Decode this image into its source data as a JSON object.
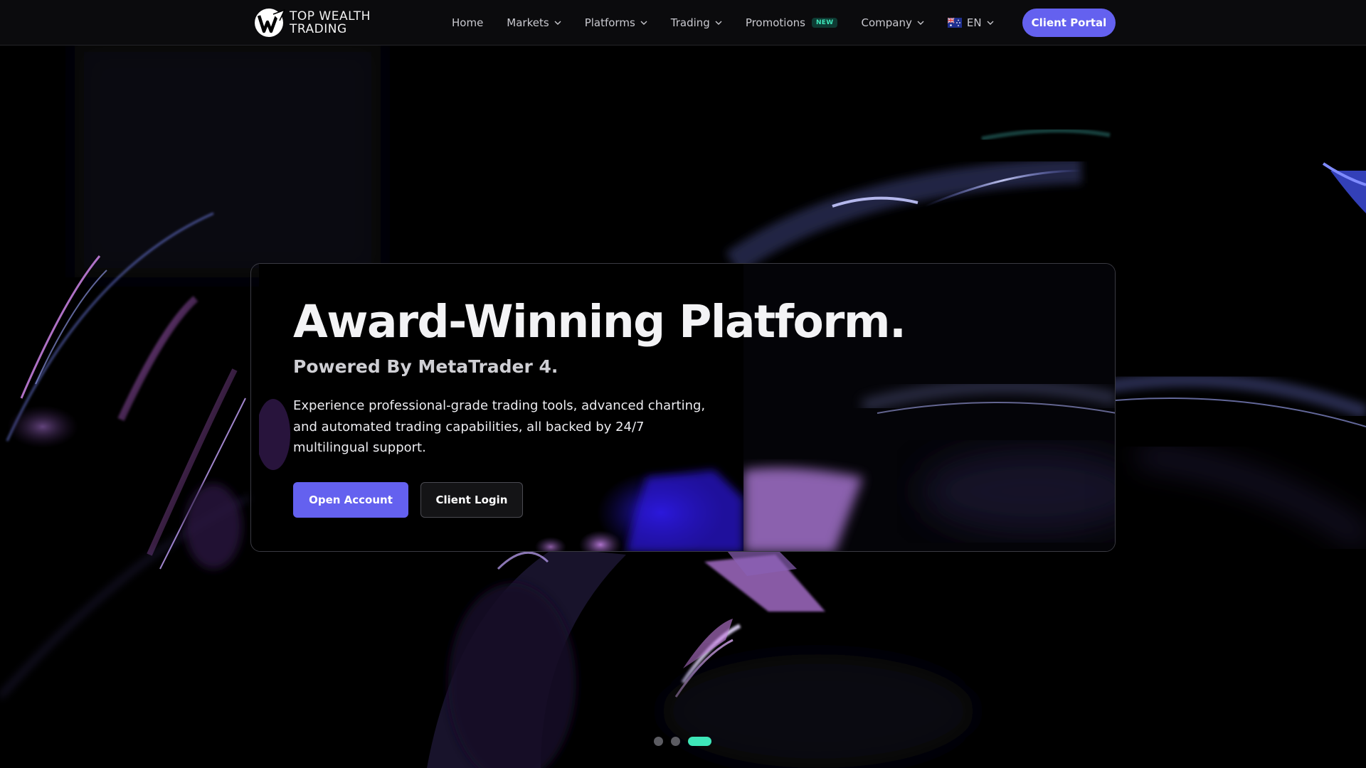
{
  "header": {
    "logo_line1": "TOP WEALTH",
    "logo_line2": "TRADING",
    "nav": {
      "home": "Home",
      "markets": "Markets",
      "platforms": "Platforms",
      "trading": "Trading",
      "promotions": "Promotions",
      "promotions_badge": "NEW",
      "company": "Company",
      "language": "EN",
      "language_flag_icon": "australia-flag-icon"
    },
    "client_portal": "Client Portal"
  },
  "hero": {
    "title": "Award-Winning Platform.",
    "subtitle": "Powered By MetaTrader 4.",
    "description": "Experience professional-grade trading tools, advanced charting, and automated trading capabilities, all backed by 24/7 multilingual support.",
    "open_account": "Open Account",
    "client_login": "Client Login"
  },
  "carousel": {
    "slide_count": 3,
    "active_slide": 3
  },
  "colors": {
    "accent": "#6461ef",
    "indicator_active": "#3ee6b9",
    "background": "#000000",
    "navbar": "#0b0b0d"
  }
}
